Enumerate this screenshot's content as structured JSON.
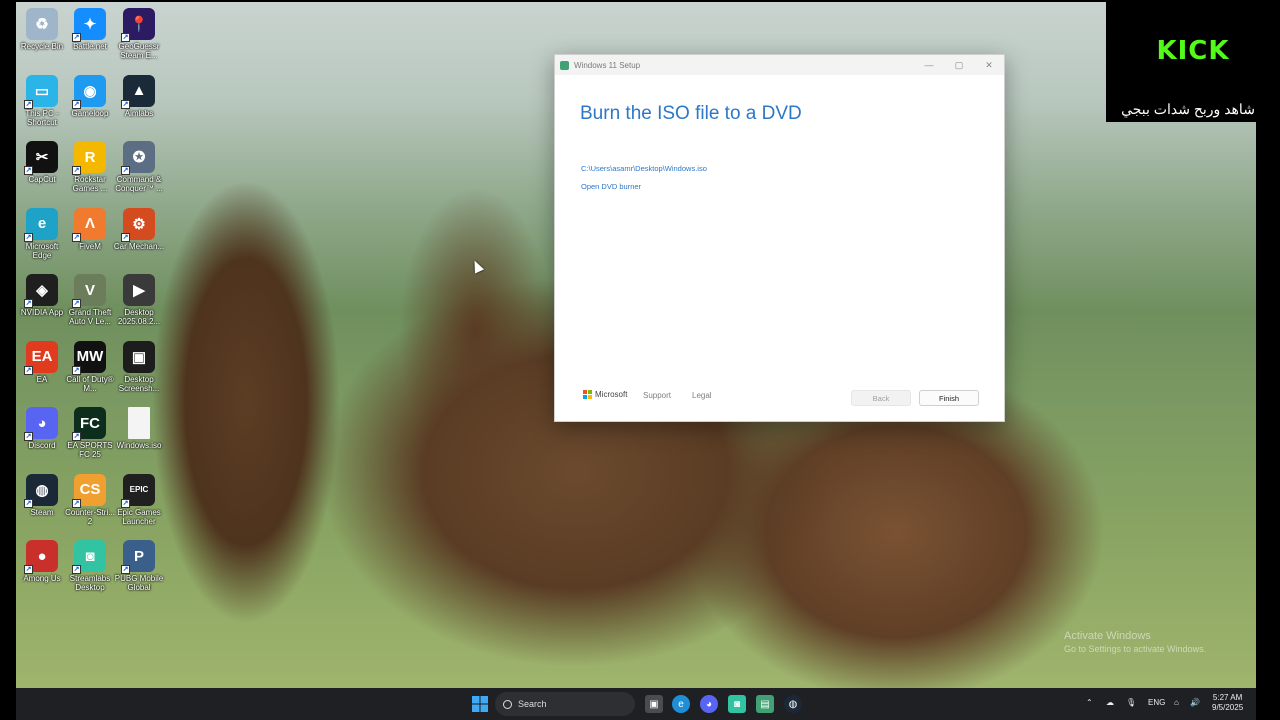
{
  "desktop": {
    "icons": [
      {
        "label": "Recycle Bin",
        "icon": "recycle-bin-icon",
        "color": "#9fb5c9",
        "glyph": "♻"
      },
      {
        "label": "Battle.net",
        "icon": "battlenet-icon",
        "color": "#148eff",
        "glyph": "✦"
      },
      {
        "label": "GeoGuessr Steam E...",
        "icon": "geoguessr-icon",
        "color": "#2c1b63",
        "glyph": "📍"
      },
      {
        "label": "This PC - Shortcut",
        "icon": "this-pc-icon",
        "color": "#2bb4e8",
        "glyph": "▭"
      },
      {
        "label": "Gameloop",
        "icon": "gameloop-icon",
        "color": "#1e9bf0",
        "glyph": "◉"
      },
      {
        "label": "Aimlabs",
        "icon": "aimlabs-icon",
        "color": "#1a2a38",
        "glyph": "▲"
      },
      {
        "label": "CapCut",
        "icon": "capcut-icon",
        "color": "#111111",
        "glyph": "✂"
      },
      {
        "label": "Rockstar Games ...",
        "icon": "rockstar-icon",
        "color": "#f5b800",
        "glyph": "R"
      },
      {
        "label": "Command & Conquer™ ...",
        "icon": "command-conquer-icon",
        "color": "#5c6e84",
        "glyph": "✪"
      },
      {
        "label": "Microsoft Edge",
        "icon": "edge-icon",
        "color": "#1ea2c8",
        "glyph": "e"
      },
      {
        "label": "FiveM",
        "icon": "fivem-icon",
        "color": "#f07a2d",
        "glyph": "Λ"
      },
      {
        "label": "Car Mechan...",
        "icon": "car-mechanic-icon",
        "color": "#d44b1f",
        "glyph": "⚙"
      },
      {
        "label": "NVIDIA App",
        "icon": "nvidia-icon",
        "color": "#1f1f1f",
        "glyph": "◈"
      },
      {
        "label": "Grand Theft Auto V Le...",
        "icon": "gta-icon",
        "color": "#6b7d5a",
        "glyph": "V"
      },
      {
        "label": "Desktop 2025.08.2...",
        "icon": "video-file-icon",
        "color": "#3a3a3a",
        "glyph": "▶"
      },
      {
        "label": "EA",
        "icon": "ea-icon",
        "color": "#e03a1f",
        "glyph": "EA"
      },
      {
        "label": "Call of Duty® M...",
        "icon": "call-of-duty-icon",
        "color": "#111111",
        "glyph": "MW"
      },
      {
        "label": "Desktop Screensh...",
        "icon": "screenshot-file-icon",
        "color": "#1d1d1d",
        "glyph": "▣"
      },
      {
        "label": "Discord",
        "icon": "discord-icon",
        "color": "#5865f2",
        "glyph": "◕"
      },
      {
        "label": "EA SPORTS FC 25",
        "icon": "ea-fc-icon",
        "color": "#0d2e1c",
        "glyph": "FC"
      },
      {
        "label": "Windows.iso",
        "icon": "iso-file-icon",
        "color": "#f4f4f4",
        "glyph": ""
      },
      {
        "label": "Steam",
        "icon": "steam-icon",
        "color": "#1b2838",
        "glyph": "◍"
      },
      {
        "label": "Counter-Stri... 2",
        "icon": "counter-strike-icon",
        "color": "#f0a030",
        "glyph": "CS"
      },
      {
        "label": "Epic Games Launcher",
        "icon": "epic-games-icon",
        "color": "#202020",
        "glyph": "EPIC"
      },
      {
        "label": "Among Us",
        "icon": "among-us-icon",
        "color": "#c9302c",
        "glyph": "●"
      },
      {
        "label": "Streamlabs Desktop",
        "icon": "streamlabs-icon",
        "color": "#31c3a2",
        "glyph": "◙"
      },
      {
        "label": "PUBG Mobile Global",
        "icon": "pubg-icon",
        "color": "#3a5f8a",
        "glyph": "P"
      }
    ]
  },
  "setup_window": {
    "title": "Windows 11 Setup",
    "minimize": "—",
    "maximize": "▢",
    "close": "✕",
    "heading": "Burn the ISO file to a DVD",
    "iso_path": "C:\\Users\\asamr\\Desktop\\Windows.iso",
    "open_burner_label": "Open DVD burner",
    "brand": "Microsoft",
    "support_label": "Support",
    "legal_label": "Legal",
    "back_label": "Back",
    "finish_label": "Finish"
  },
  "overlay": {
    "kick_logo": "KICK",
    "promo_text": "شاهد وربح شدات ببجي",
    "kick_color": "#53fc18"
  },
  "watermark": {
    "line1": "Activate Windows",
    "line2": "Go to Settings to activate Windows."
  },
  "taskbar": {
    "search_placeholder": "Search",
    "language": "ENG",
    "time": "5:27 AM",
    "date": "9/5/2025"
  }
}
